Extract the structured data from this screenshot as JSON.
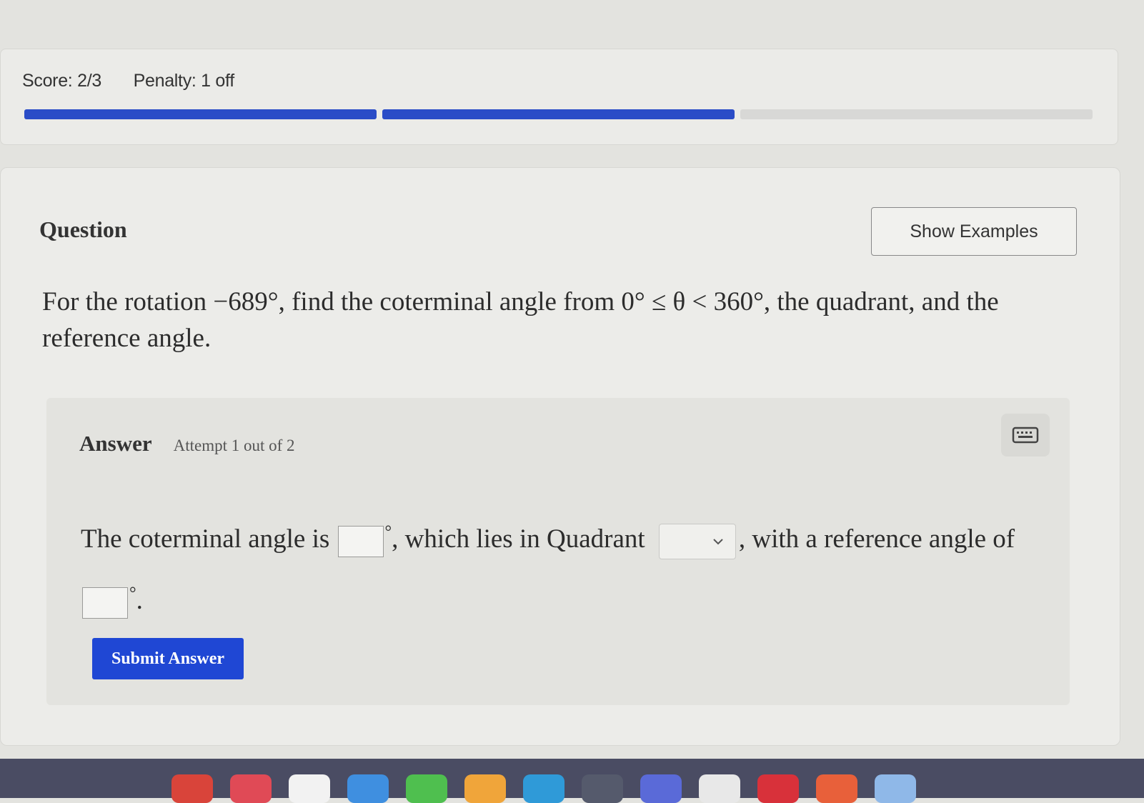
{
  "score": {
    "score_text": "Score: 2/3",
    "penalty_text": "Penalty: 1 off",
    "progress_segments": [
      {
        "filled": true
      },
      {
        "filled": true
      },
      {
        "filled": false
      }
    ],
    "progress_color": "#2a4cc7"
  },
  "question": {
    "heading": "Question",
    "show_examples_label": "Show Examples",
    "prompt": "For the rotation −689°, find the coterminal angle from 0° ≤ θ < 360°, the quadrant, and the reference angle."
  },
  "answer": {
    "label": "Answer",
    "attempt": "Attempt 1 out of 2",
    "keyboard_icon": "keyboard-icon",
    "part1": "The coterminal angle is",
    "degree_symbol": "°",
    "part2": ", which lies in Quadrant",
    "part3": ", with a reference angle of",
    "end_punct": ".",
    "coterminal_value": "",
    "quadrant_value": "",
    "reference_value": "",
    "submit_label": "Submit Answer",
    "submit_color": "#1f47d4"
  }
}
